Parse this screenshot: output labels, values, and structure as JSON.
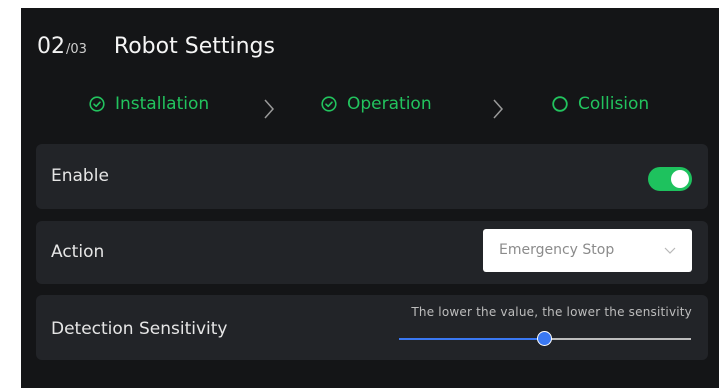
{
  "header": {
    "step_current": "02",
    "step_total": "/03",
    "title": "Robot Settings"
  },
  "steps": [
    {
      "label": "Installation",
      "state": "completed",
      "icon": "check-circle-icon"
    },
    {
      "label": "Operation",
      "state": "completed",
      "icon": "check-circle-icon"
    },
    {
      "label": "Collision",
      "state": "current",
      "icon": "circle-icon"
    }
  ],
  "settings": {
    "enable": {
      "label": "Enable",
      "value": true
    },
    "action": {
      "label": "Action",
      "value": "Emergency Stop"
    },
    "sensitivity": {
      "label": "Detection Sensitivity",
      "hint": "The lower the value, the lower the sensitivity",
      "value_fraction": 0.5
    }
  },
  "colors": {
    "background": "#141517",
    "card": "#222428",
    "accent_green": "#22c35e",
    "slider_blue": "#3a78f2"
  }
}
